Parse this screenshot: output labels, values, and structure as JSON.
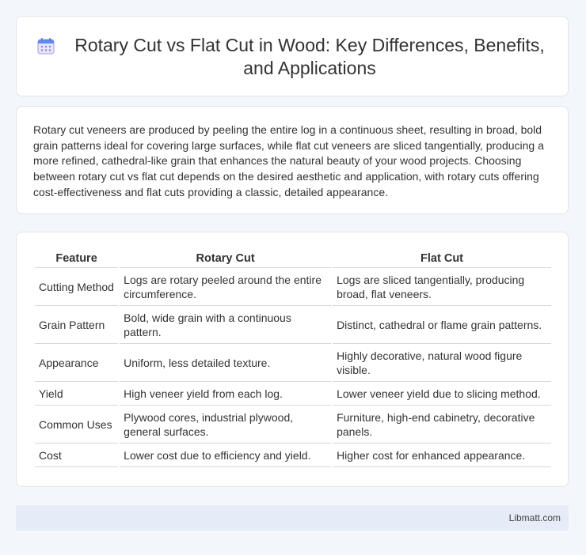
{
  "header": {
    "icon": "calendar-icon",
    "title": "Rotary Cut vs Flat Cut in Wood: Key Differences, Benefits, and Applications"
  },
  "summary": {
    "text": "Rotary cut veneers are produced by peeling the entire log in a continuous sheet, resulting in broad, bold grain patterns ideal for covering large surfaces, while flat cut veneers are sliced tangentially, producing a more refined, cathedral-like grain that enhances the natural beauty of your wood projects. Choosing between rotary cut vs flat cut depends on the desired aesthetic and application, with rotary cuts offering cost-effectiveness and flat cuts providing a classic, detailed appearance."
  },
  "table": {
    "headers": [
      "Feature",
      "Rotary Cut",
      "Flat Cut"
    ],
    "rows": [
      [
        "Cutting Method",
        "Logs are rotary peeled around the entire circumference.",
        "Logs are sliced tangentially, producing broad, flat veneers."
      ],
      [
        "Grain Pattern",
        "Bold, wide grain with a continuous pattern.",
        "Distinct, cathedral or flame grain patterns."
      ],
      [
        "Appearance",
        "Uniform, less detailed texture.",
        "Highly decorative, natural wood figure visible."
      ],
      [
        "Yield",
        "High veneer yield from each log.",
        "Lower veneer yield due to slicing method."
      ],
      [
        "Common Uses",
        "Plywood cores, industrial plywood, general surfaces.",
        "Furniture, high-end cabinetry, decorative panels."
      ],
      [
        "Cost",
        "Lower cost due to efficiency and yield.",
        "Higher cost for enhanced appearance."
      ]
    ]
  },
  "footer": {
    "text": "Libmatt.com"
  },
  "colors": {
    "page_background": "#f3f6fb",
    "card_background": "#ffffff",
    "footer_background": "#e6ecf7",
    "icon_accent": "#5b8def"
  }
}
